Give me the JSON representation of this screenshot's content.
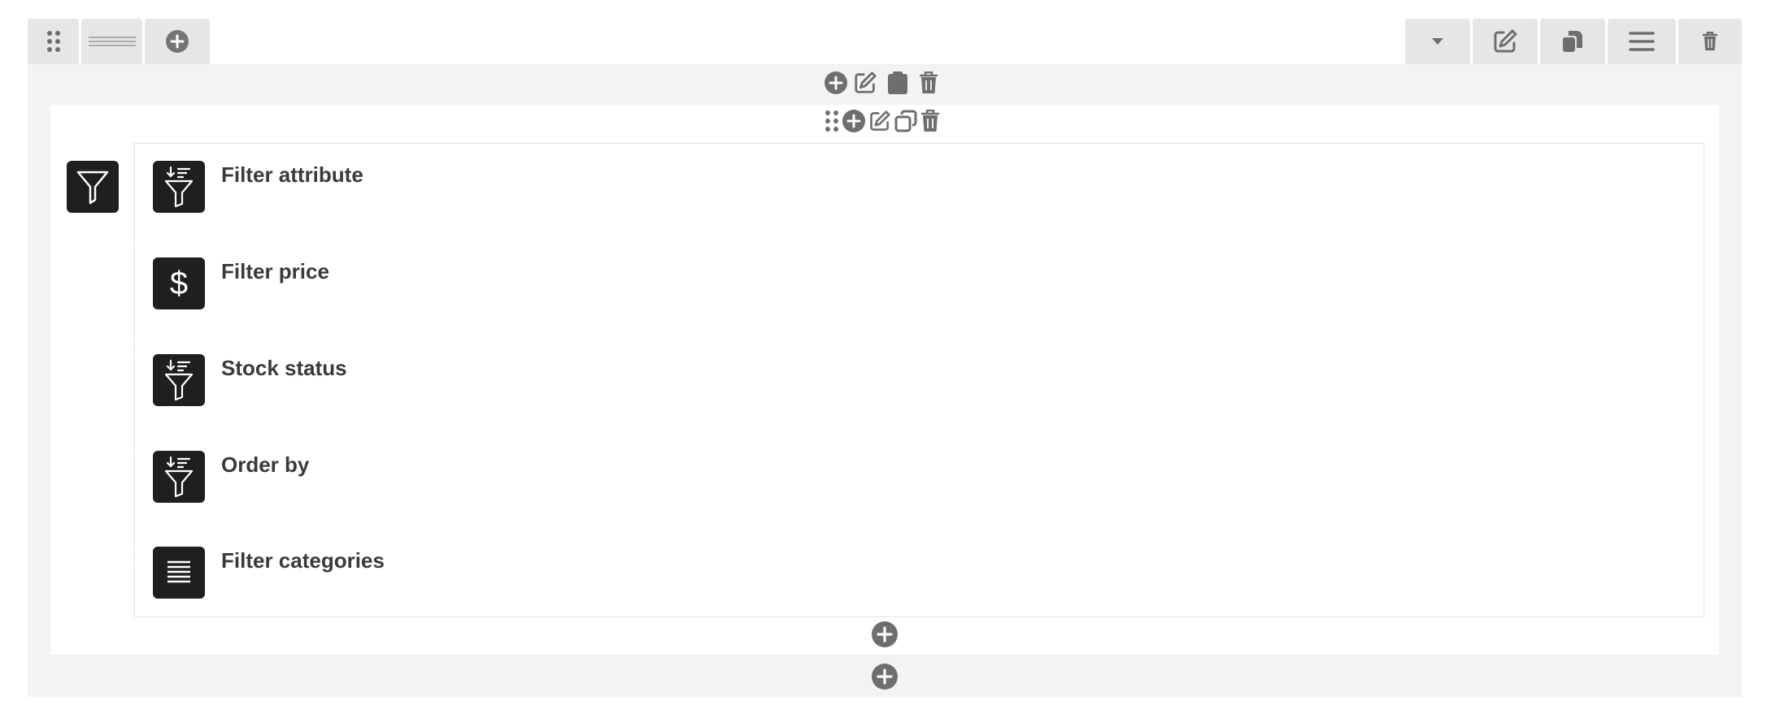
{
  "toolbar": {
    "left_buttons": [
      "drag-handle",
      "layout-lines",
      "add"
    ],
    "right_buttons": [
      "dropdown",
      "edit",
      "duplicate",
      "menu",
      "delete"
    ]
  },
  "section_controls": [
    "add",
    "edit",
    "paste",
    "delete"
  ],
  "column_controls": [
    "drag",
    "add",
    "edit",
    "duplicate",
    "delete"
  ],
  "widget": {
    "icon": "funnel-icon"
  },
  "items": [
    {
      "label": "Filter attribute",
      "icon": "sort-filter-icon"
    },
    {
      "label": "Filter price",
      "icon": "dollar-icon"
    },
    {
      "label": "Stock status",
      "icon": "sort-filter-icon"
    },
    {
      "label": "Order by",
      "icon": "sort-filter-icon"
    },
    {
      "label": "Filter categories",
      "icon": "text-lines-icon"
    }
  ],
  "colors": {
    "toolbar_bg": "#e6e6e6",
    "section_bg": "#f3f3f3",
    "icon_tile_bg": "#1f1f1f",
    "control_gray": "#757575"
  }
}
